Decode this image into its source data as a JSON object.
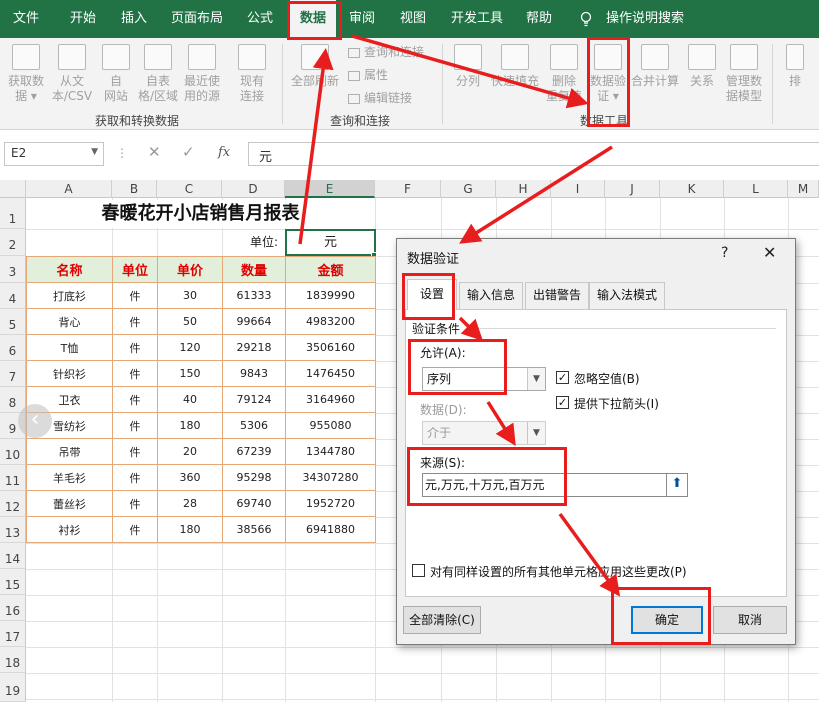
{
  "menu": {
    "items": [
      "文件",
      "开始",
      "插入",
      "页面布局",
      "公式",
      "数据",
      "审阅",
      "视图",
      "开发工具",
      "帮助"
    ],
    "active_index": 5,
    "tell_me": "操作说明搜索"
  },
  "ribbon": {
    "get_transform": {
      "buttons": [
        [
          "获取数",
          "据 ▾"
        ],
        [
          "从文",
          "本/CSV"
        ],
        [
          "自",
          "网站"
        ],
        [
          "自表",
          "格/区域"
        ],
        [
          "最近使",
          "用的源"
        ],
        [
          "现有",
          "连接"
        ]
      ],
      "label": "获取和转换数据"
    },
    "queries": {
      "refresh": [
        "全部刷新",
        ""
      ],
      "items": [
        "查询和连接",
        "属性",
        "编辑链接"
      ],
      "label": "查询和连接"
    },
    "data_tools": {
      "buttons": [
        [
          "分列",
          ""
        ],
        [
          "快速填充",
          ""
        ],
        [
          "删除",
          "重复值"
        ],
        [
          "数据验",
          "证 ▾"
        ],
        [
          "合并计算",
          ""
        ],
        [
          "关系",
          ""
        ],
        [
          "管理数",
          "据模型"
        ]
      ],
      "label": "数据工具"
    },
    "edge_text": "排"
  },
  "formula_bar": {
    "name_box": "E2",
    "cancel": "✕",
    "enter": "✓",
    "fx": "fx",
    "value": "元"
  },
  "columns": [
    "A",
    "B",
    "C",
    "D",
    "E",
    "F",
    "G",
    "H",
    "I",
    "J",
    "K",
    "L",
    "M"
  ],
  "rows": [
    "1",
    "2",
    "3",
    "4",
    "5",
    "6",
    "7",
    "8",
    "9",
    "10",
    "11",
    "12",
    "13",
    "14",
    "15",
    "16",
    "17",
    "18",
    "19"
  ],
  "sheet": {
    "title": "春暖花开小店销售月报表",
    "unit_label": "单位:",
    "unit_value": "元",
    "headers": [
      "名称",
      "单位",
      "单价",
      "数量",
      "金额"
    ],
    "rows": [
      [
        "打底衫",
        "件",
        "30",
        "61333",
        "1839990"
      ],
      [
        "背心",
        "件",
        "50",
        "99664",
        "4983200"
      ],
      [
        "T恤",
        "件",
        "120",
        "29218",
        "3506160"
      ],
      [
        "针织衫",
        "件",
        "150",
        "9843",
        "1476450"
      ],
      [
        "卫衣",
        "件",
        "40",
        "79124",
        "3164960"
      ],
      [
        "雪纺衫",
        "件",
        "180",
        "5306",
        "955080"
      ],
      [
        "吊带",
        "件",
        "20",
        "67239",
        "1344780"
      ],
      [
        "羊毛衫",
        "件",
        "360",
        "95298",
        "34307280"
      ],
      [
        "蕾丝衫",
        "件",
        "28",
        "69740",
        "1952720"
      ],
      [
        "衬衫",
        "件",
        "180",
        "38566",
        "6941880"
      ]
    ]
  },
  "dialog": {
    "title": "数据验证",
    "help": "?",
    "close": "✕",
    "tabs": [
      "设置",
      "输入信息",
      "出错警告",
      "输入法模式"
    ],
    "section": "验证条件",
    "allow_label": "允许(A):",
    "allow_value": "序列",
    "ignore_blank": "忽略空值(B)",
    "ignore_blank_checked": true,
    "dropdown_arrow": "提供下拉箭头(I)",
    "dropdown_arrow_checked": true,
    "data_label": "数据(D):",
    "data_value": "介于",
    "source_label": "来源(S):",
    "source_value": "元,万元,十万元,百万元",
    "apply_all": "对有同样设置的所有其他单元格应用这些更改(P)",
    "apply_all_checked": false,
    "clear_all": "全部清除(C)",
    "ok": "确定",
    "cancel": "取消"
  },
  "colors": {
    "excel_green": "#217346",
    "annotation_red": "#e81e1e",
    "header_fill": "#e2efda",
    "header_text": "#e00000",
    "table_border": "#e4a775"
  }
}
